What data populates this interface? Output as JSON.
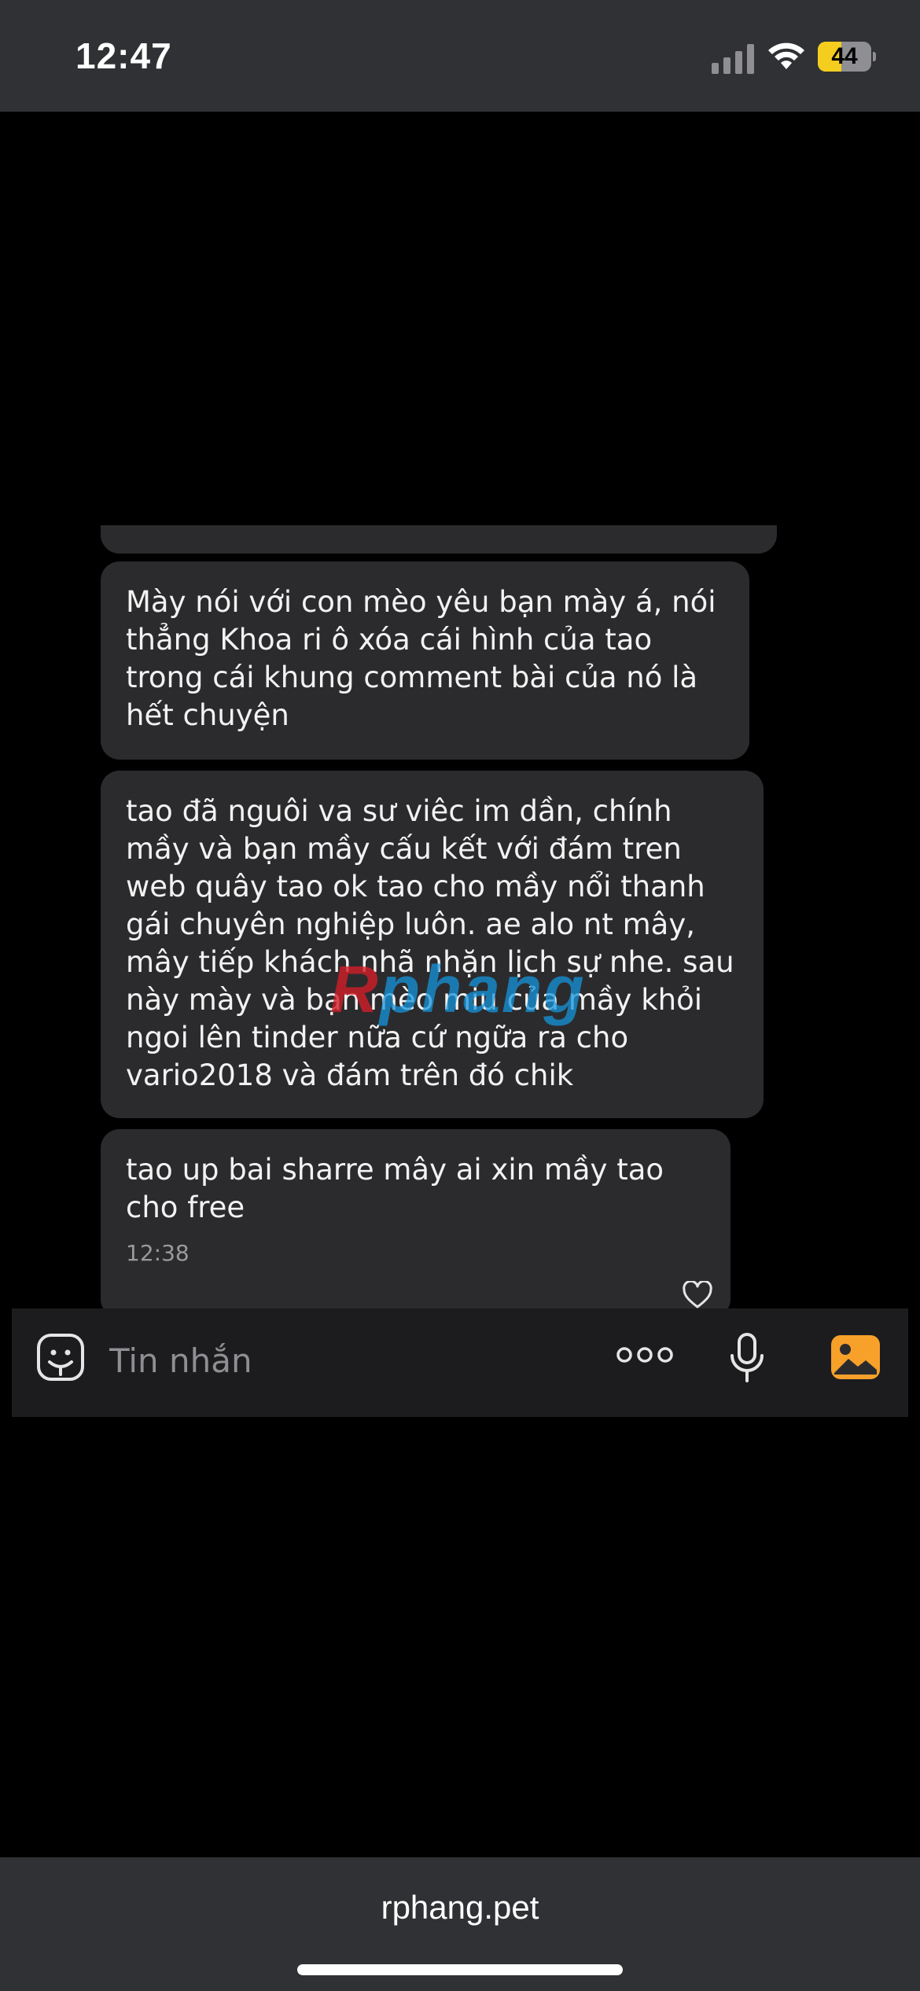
{
  "status_bar": {
    "time": "12:47",
    "battery_level": "44",
    "battery_fraction": 0.44,
    "battery_color": "#f4cd1e",
    "icons": [
      "cellular-signal-icon",
      "wifi-icon",
      "battery-icon"
    ]
  },
  "messages": [
    {
      "text": "Mày nói với con mèo yêu bạn mày á, nói thẳng Khoa ri ô xóa cái hình của tao trong cái khung comment bài của nó là hết chuyện"
    },
    {
      "text": "tao đã nguôi va sư viêc im dần, chính mầy và bạn mầy cấu kết với đám tren web quây tao ok tao cho mầy nổi thanh gái chuyên nghiệp luôn. ae alo nt mây, mây tiếp khách nhã nhặn lịch sự nhe. sau này mày và bạn mèo miu của mầy khỏi ngoi lên tinder nữa cứ ngữa ra cho vario2018 và đám trên đó chik"
    },
    {
      "text": "tao up bai sharre mây ai xin mầy tao cho free",
      "time": "12:38"
    }
  ],
  "reaction": {
    "icon": "heart-icon"
  },
  "watermark": {
    "first_letter": "R",
    "rest": "phang"
  },
  "composer": {
    "placeholder": "Tin nhắn",
    "icons": [
      "sticker-icon",
      "more-options-icon",
      "microphone-icon",
      "gallery-icon"
    ],
    "gallery_color": "#f7a02a"
  },
  "browser": {
    "url": "rphang.pet"
  }
}
